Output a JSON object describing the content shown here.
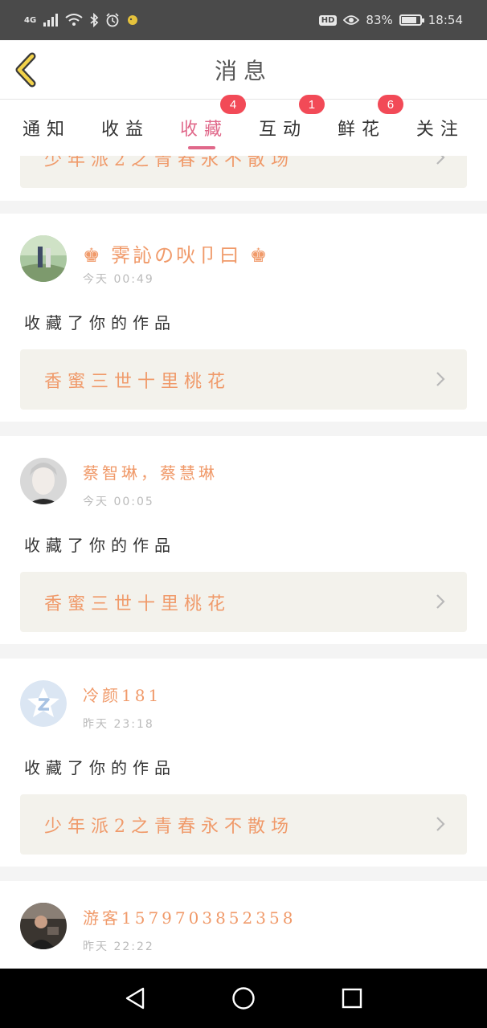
{
  "status_bar": {
    "network": "4G",
    "hd": "HD",
    "battery_percent": "83%",
    "battery_level": 0.83,
    "time": "18:54"
  },
  "header": {
    "title": "消息"
  },
  "tabs": [
    {
      "label": "通知",
      "badge": ""
    },
    {
      "label": "收益",
      "badge": ""
    },
    {
      "label": "收藏",
      "badge": "4",
      "active": true
    },
    {
      "label": "互动",
      "badge": "1"
    },
    {
      "label": "鲜花",
      "badge": "6"
    },
    {
      "label": "关注",
      "badge": ""
    }
  ],
  "partial_card": {
    "work_title": "少年派2之青春永不散场"
  },
  "items": [
    {
      "user": "♚ 霁訫の吙卩曰 ♚",
      "time": "今天 00:49",
      "action": "收藏了你的作品",
      "work_title": "香蜜三世十里桃花"
    },
    {
      "user": "蔡智琳，蔡慧琳",
      "time": "今天 00:05",
      "action": "收藏了你的作品",
      "work_title": "香蜜三世十里桃花"
    },
    {
      "user": "冷颜181",
      "time": "昨天 23:18",
      "action": "收藏了你的作品",
      "work_title": "少年派2之青春永不散场"
    },
    {
      "user": "游客1579703852358",
      "time": "昨天 22:22",
      "action": "",
      "work_title": ""
    }
  ],
  "colors": {
    "accent": "#e0688a",
    "badge": "#f24a57",
    "user_name": "#f09a6a",
    "work_bg": "#f3f2ec",
    "status_bar": "#4a4a4a"
  }
}
